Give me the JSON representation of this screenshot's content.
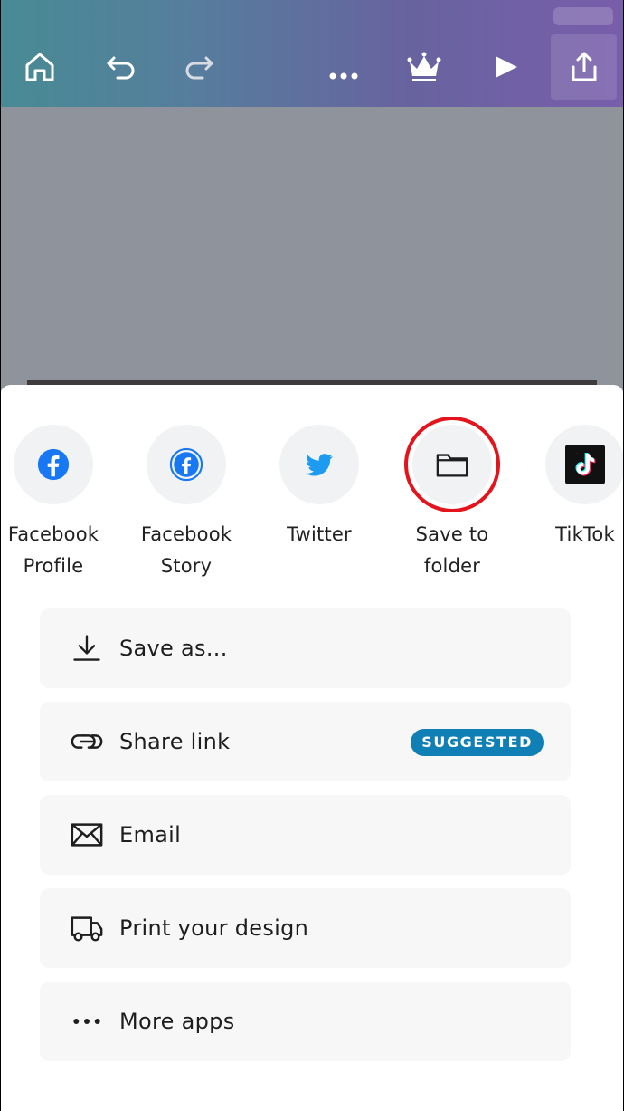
{
  "toolbar": {
    "icons": [
      "home-icon",
      "undo-icon",
      "redo-icon",
      "more-icon",
      "crown-icon",
      "play-icon",
      "share-icon"
    ]
  },
  "share_targets": [
    {
      "label": "Facebook\nProfile",
      "icon": "facebook-icon"
    },
    {
      "label": "Facebook\nStory",
      "icon": "facebook-story-icon"
    },
    {
      "label": "Twitter",
      "icon": "twitter-icon"
    },
    {
      "label": "Save to\nfolder",
      "icon": "folder-icon",
      "highlighted": true
    },
    {
      "label": "TikTok",
      "icon": "tiktok-icon"
    }
  ],
  "options": [
    {
      "label": "Save as...",
      "icon": "download-icon"
    },
    {
      "label": "Share link",
      "icon": "link-icon",
      "badge": "SUGGESTED"
    },
    {
      "label": "Email",
      "icon": "mail-icon"
    },
    {
      "label": "Print your design",
      "icon": "truck-icon"
    },
    {
      "label": "More apps",
      "icon": "more-horizontal-icon"
    }
  ],
  "colors": {
    "facebook": "#1877f2",
    "twitter": "#1d9bf0",
    "highlight_ring": "#e3141b",
    "badge": "#0f7fb5"
  }
}
